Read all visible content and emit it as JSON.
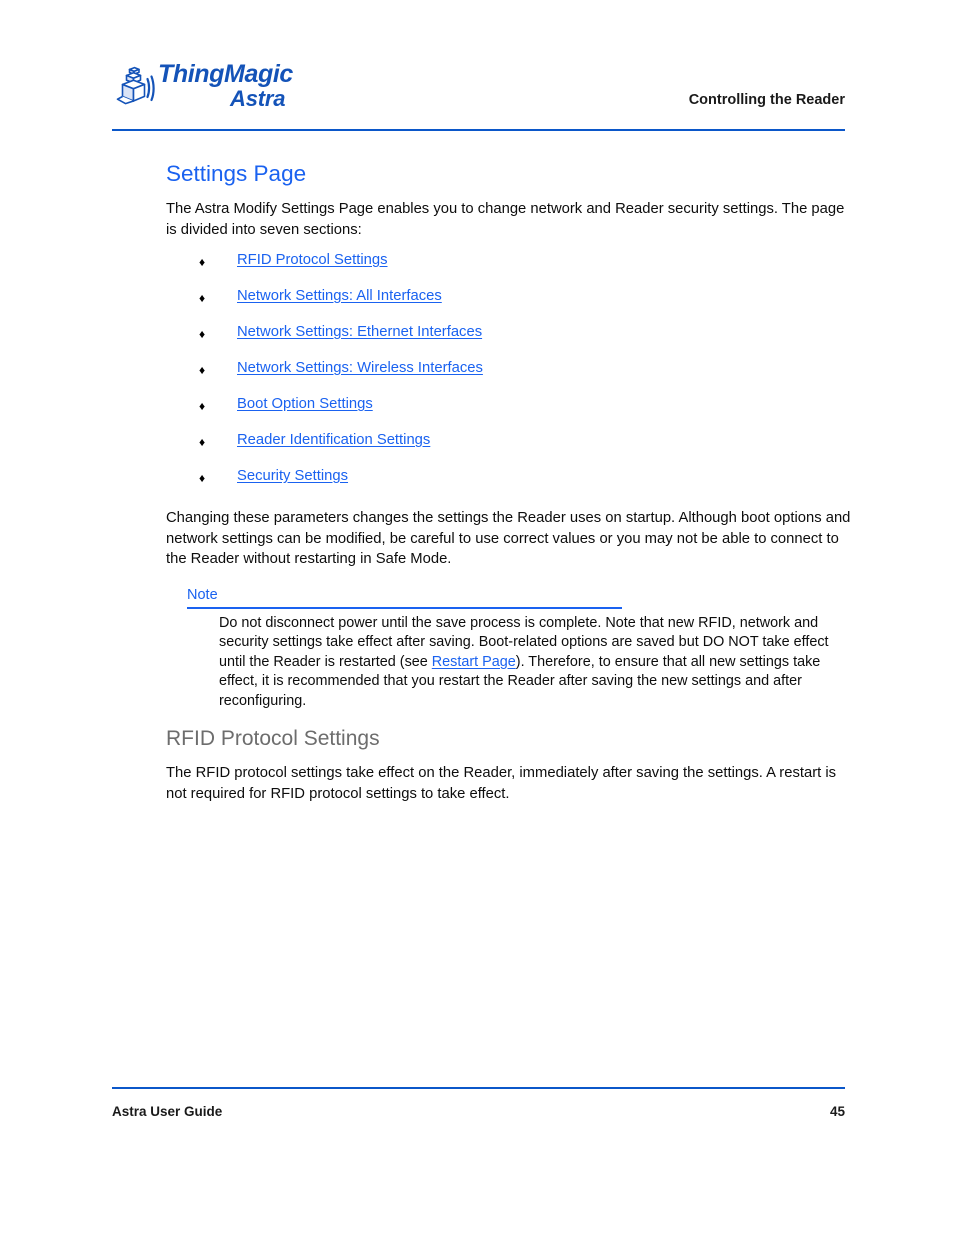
{
  "header": {
    "logo": {
      "icon_name": "thingmagic-cube-logo-icon",
      "line1": "ThingMagic",
      "line2": "Astra"
    },
    "running_head": "Controlling the Reader",
    "rule_color": "#0b57c9"
  },
  "main": {
    "title": "Settings Page",
    "title_color": "#1a62f0",
    "intro_paragraph": "The Astra Modify Settings Page enables you to change network and Reader security settings. The page is divided into seven sections:",
    "bullet_symbol": "♦",
    "links": [
      {
        "label": "RFID Protocol Settings"
      },
      {
        "label": "Network Settings: All Interfaces"
      },
      {
        "label": "Network Settings: Ethernet Interfaces "
      },
      {
        "label": "Network Settings: Wireless Interfaces"
      },
      {
        "label": "Boot Option Settings "
      },
      {
        "label": "Reader Identification Settings"
      },
      {
        "label": "Security Settings"
      }
    ],
    "link_color": "#1a62f0",
    "changing_paragraph": "Changing these parameters changes the settings the Reader uses on startup. Although boot options and network settings can be modified, be careful to use correct values or you may not be able to connect to the Reader without restarting in Safe Mode.",
    "note": {
      "label": "Note",
      "text_before_link": "Do not disconnect power until the save process is complete. Note that new RFID, network and security settings take effect after saving. Boot-related options are saved but DO NOT take effect until the Reader is restarted (see ",
      "link_label": "Restart Page",
      "text_after_link": "). Therefore, to ensure that all new settings take effect, it is recommended that you restart the Reader after saving the new settings and after reconfiguring."
    },
    "subsection": {
      "title": "RFID Protocol Settings",
      "title_color": "#6d6d6d",
      "paragraph": "The RFID protocol settings take effect on the Reader, immediately after saving the settings. A restart is not required for RFID protocol settings to take effect."
    }
  },
  "footer": {
    "document_title": "Astra User Guide",
    "page_number": "45",
    "rule_color": "#0b57c9"
  }
}
